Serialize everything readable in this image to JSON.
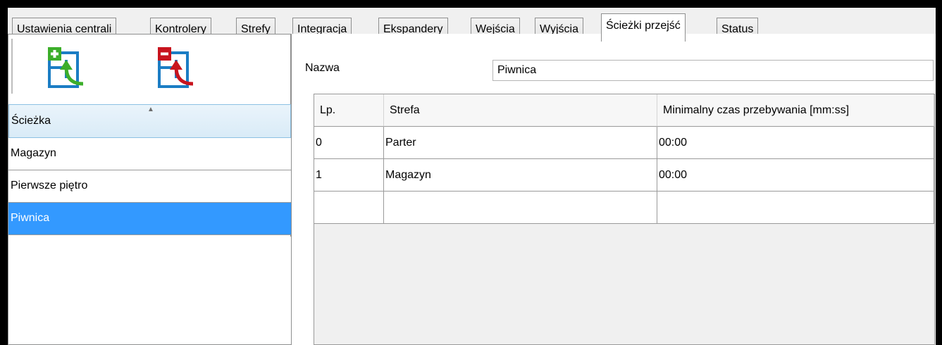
{
  "tabs": [
    "Ustawienia centrali",
    "Kontrolery",
    "Strefy",
    "Integracja",
    "Ekspandery",
    "Wejścia",
    "Wyjścia",
    "Ścieżki przejść",
    "Status"
  ],
  "active_tab": "Ścieżki przejść",
  "toolbar": {
    "add_icon": "add-path-icon",
    "remove_icon": "remove-path-icon",
    "add_color": "#3cae2a",
    "remove_color": "#c8141e",
    "icon_blue": "#1b7dc4"
  },
  "list": {
    "header": "Ścieżka",
    "sort_icon": "sort-ascending-icon",
    "items": [
      "Magazyn",
      "Pierwsze piętro",
      "Piwnica"
    ],
    "selected": "Piwnica",
    "selection_color": "#3399ff"
  },
  "details": {
    "name_label": "Nazwa",
    "name_value": "Piwnica",
    "grid": {
      "columns": [
        "Lp.",
        "Strefa",
        "Minimalny czas przebywania [mm:ss]"
      ],
      "rows": [
        [
          "0",
          "Parter",
          "00:00"
        ],
        [
          "1",
          "Magazyn",
          "00:00"
        ],
        [
          "",
          "",
          ""
        ]
      ]
    }
  }
}
